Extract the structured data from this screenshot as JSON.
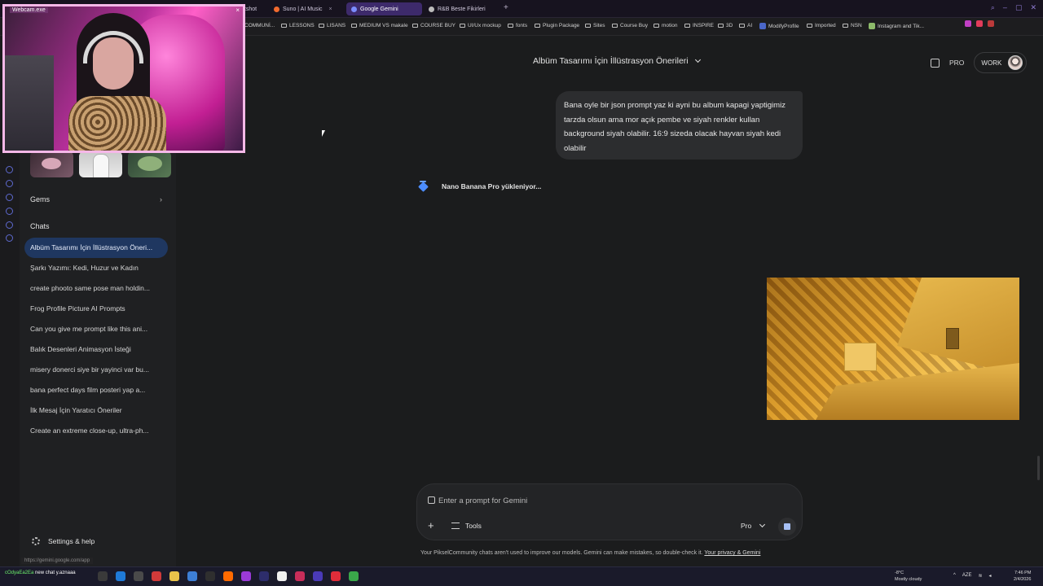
{
  "browser": {
    "tabs": [
      {
        "label": "atshot",
        "active": false
      },
      {
        "label": "Suno | AI Music",
        "active": false
      },
      {
        "label": "Google Gemini",
        "active": true
      },
      {
        "label": "R&B Beste Fikirleri",
        "active": false
      }
    ],
    "bookmarks": [
      "COMMUNİ...",
      "LESSONS",
      "LISANS",
      "MEDIUM VS makale",
      "COURSE BUY",
      "UI/Ux mockup",
      "fonts",
      "Plugin Package",
      "Sites",
      "Course Buy",
      "motion",
      "INSPIRE",
      "3D",
      "AI",
      "ModifyProfile",
      "Imported",
      "NSN",
      "Instagram and Tik..."
    ]
  },
  "webcam": {
    "title": "Webcam.exe",
    "close": "×"
  },
  "sidebar": {
    "gems_label": "Gems",
    "chats_label": "Chats",
    "chats": [
      {
        "label": "Albüm Tasarımı İçin İllüstrasyon Öneri...",
        "active": true
      },
      {
        "label": "Şarkı Yazımı: Kedi, Huzur ve Kadın",
        "active": false
      },
      {
        "label": "create phooto same pose man holdin...",
        "active": false
      },
      {
        "label": "Frog Profile Picture AI Prompts",
        "active": false
      },
      {
        "label": "Can you give me prompt like this ani...",
        "active": false
      },
      {
        "label": "Balık Desenleri Animasyon İsteği",
        "active": false
      },
      {
        "label": "misery donerci siye bir yayinci var bu...",
        "active": false
      },
      {
        "label": "bana perfect days film posteri yap a...",
        "active": false
      },
      {
        "label": "İlk Mesaj İçin Yaratıcı Öneriler",
        "active": false
      },
      {
        "label": "Create an extreme close-up, ultra-ph...",
        "active": false
      }
    ],
    "settings_label": "Settings & help",
    "status_url": "https://gemini.google.com/app"
  },
  "header": {
    "title": "Albüm Tasarımı İçin İllüstrasyon Önerileri",
    "pro_label": "PRO",
    "work_label": "WORK"
  },
  "conversation": {
    "user_message": "Bana oyle bir json prompt yaz ki ayni bu album kapagi yaptigimiz tarzda olsun ama mor açık pembe ve siyah renkler kullan background siyah olabilir. 16:9 sizeda olacak hayvan siyah kedi olabilir",
    "loading_text": "Nano Banana Pro yükleniyor..."
  },
  "prompt": {
    "placeholder": "Enter a prompt for Gemini",
    "tools_label": "Tools",
    "model_label": "Pro",
    "add_symbol": "+"
  },
  "disclaimer": {
    "text": "Your PikselCommunity chats aren't used to improve our models. Gemini can make mistakes, so double-check it. ",
    "link": "Your privacy & Gemini"
  },
  "taskbar": {
    "chat_user": "cOdyaEa2Ea",
    "chat_text": "new chat y.aznaaa",
    "weather_temp": "-8°C",
    "weather_desc": "Mostly cloudy",
    "lang": "AZE",
    "time": "7:46 PM",
    "date": "2/4/2026"
  },
  "colors": {
    "bg": "#1b1c1d",
    "sidebar": "#1f2022",
    "active_chat": "#1f3760",
    "accent_blue": "#4c8dff",
    "webcam_border": "#f5b8e8"
  }
}
